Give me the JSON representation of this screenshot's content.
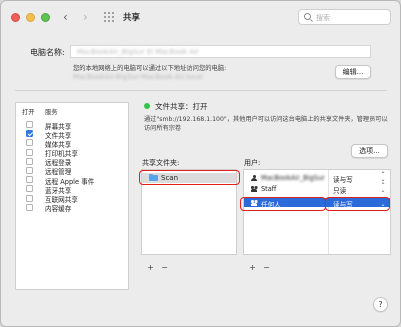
{
  "window": {
    "title": "共享",
    "search_placeholder": "搜索"
  },
  "computer_name": {
    "label": "电脑名称:",
    "value": "MacBookAir_BigSur El MacBook Air",
    "local_note": "您的本地网络上的电脑可以通过以下地址访问您的电脑:",
    "local_address": "MacBookAir-BigSur-MacBook-Air.local",
    "edit_button": "编辑..."
  },
  "services": {
    "header_on": "打开",
    "header_service": "服务",
    "items": [
      {
        "name": "屏幕共享",
        "checked": false
      },
      {
        "name": "文件共享",
        "checked": true
      },
      {
        "name": "媒体共享",
        "checked": false
      },
      {
        "name": "打印机共享",
        "checked": false
      },
      {
        "name": "远程登录",
        "checked": false
      },
      {
        "name": "远程管理",
        "checked": false
      },
      {
        "name": "远程 Apple 事件",
        "checked": false
      },
      {
        "name": "蓝牙共享",
        "checked": false
      },
      {
        "name": "互联网共享",
        "checked": false
      },
      {
        "name": "内容缓存",
        "checked": false
      }
    ]
  },
  "file_sharing": {
    "status_color": "#33c24a",
    "status_text": "文件共享：打开",
    "description": "通过\"smb://192.168.1.100\"，其他用户可以访问这台电脑上的共享文件夹，管理员可以访问所有宗卷",
    "options_button": "选项...",
    "shared_folders_label": "共享文件夹:",
    "users_label": "用户:",
    "folders": [
      {
        "name": "Scan",
        "icon": "folder-icon"
      }
    ],
    "users": [
      {
        "name": "MacBookAir_BigSur",
        "permission": "读与写",
        "icon": "person-icon",
        "blurred": true
      },
      {
        "name": "Staff",
        "permission": "只读",
        "icon": "group-icon",
        "blurred": false
      },
      {
        "name": "任何人",
        "permission": "读与写",
        "icon": "everyone-icon",
        "blurred": false,
        "selected": true
      }
    ],
    "add_label": "+",
    "remove_label": "−"
  },
  "help_label": "?",
  "highlight_color": "#e0201b",
  "accent_color": "#2b6ad9"
}
